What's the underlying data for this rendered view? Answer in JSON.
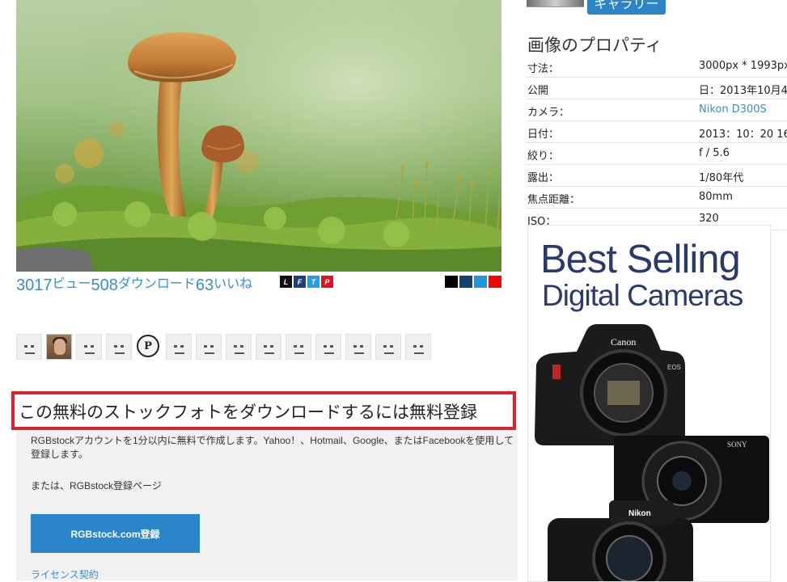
{
  "photo": {
    "subject": "mushroom-on-moss"
  },
  "stats": {
    "views_count": "3017",
    "views_label": "ビュー",
    "downloads_count": "508",
    "downloads_label": "ダウンロード",
    "likes_count": "63",
    "likes_label": "いいね"
  },
  "share": [
    {
      "letter": "L",
      "color": "#111111"
    },
    {
      "letter": "F",
      "color": "#1d3f7a"
    },
    {
      "letter": "T",
      "color": "#2b9ae0"
    },
    {
      "letter": "P",
      "color": "#e3111d"
    }
  ],
  "color_swatches": [
    "#000000",
    "#14416e",
    "#2496d6",
    "#ea0a0a"
  ],
  "avatars": [
    "face",
    "photo",
    "face",
    "face",
    "badge",
    "face",
    "face",
    "face",
    "face",
    "face",
    "face",
    "face",
    "face",
    "face"
  ],
  "registration": {
    "title": "この無料のストックフォトをダウンロードするには無料登録",
    "description": "RGBstockアカウントを1分以内に無料で作成します。Yahoo！、Hotmail、Google、またはFacebookを使用して登録します。",
    "alternative": "または、RGBstock登録ページ",
    "button_label": "RGBstock.com登録",
    "license_link": "ライセンス契約"
  },
  "gallery_button": "ギャラリー",
  "properties": {
    "title": "画像のプロパティ",
    "rows": [
      {
        "key": "寸法：",
        "value": "3000px * 1993px"
      },
      {
        "key": "公開",
        "value": "日：2013年10月4"
      },
      {
        "key": "カメラ：",
        "value": "Nikon D300S"
      },
      {
        "key": "日付：",
        "value": "2013：10：20 16"
      },
      {
        "key": "絞り：",
        "value": "f / 5.6"
      },
      {
        "key": "露出：",
        "value": "1/80年代"
      },
      {
        "key": "焦点距離：",
        "value": "80mm"
      },
      {
        "key": "ISO：",
        "value": "320"
      }
    ]
  },
  "ad": {
    "line1": "Best Selling",
    "line2": "Digital Cameras",
    "brands": [
      "Canon",
      "SONY",
      "Nikon"
    ],
    "text_color": "#2b3a6b"
  },
  "colors": {
    "link_blue": "#3a8fc9",
    "button_blue": "#2a86c8",
    "highlight_red": "#d9242f",
    "panel_gray": "#f2f1f1"
  }
}
